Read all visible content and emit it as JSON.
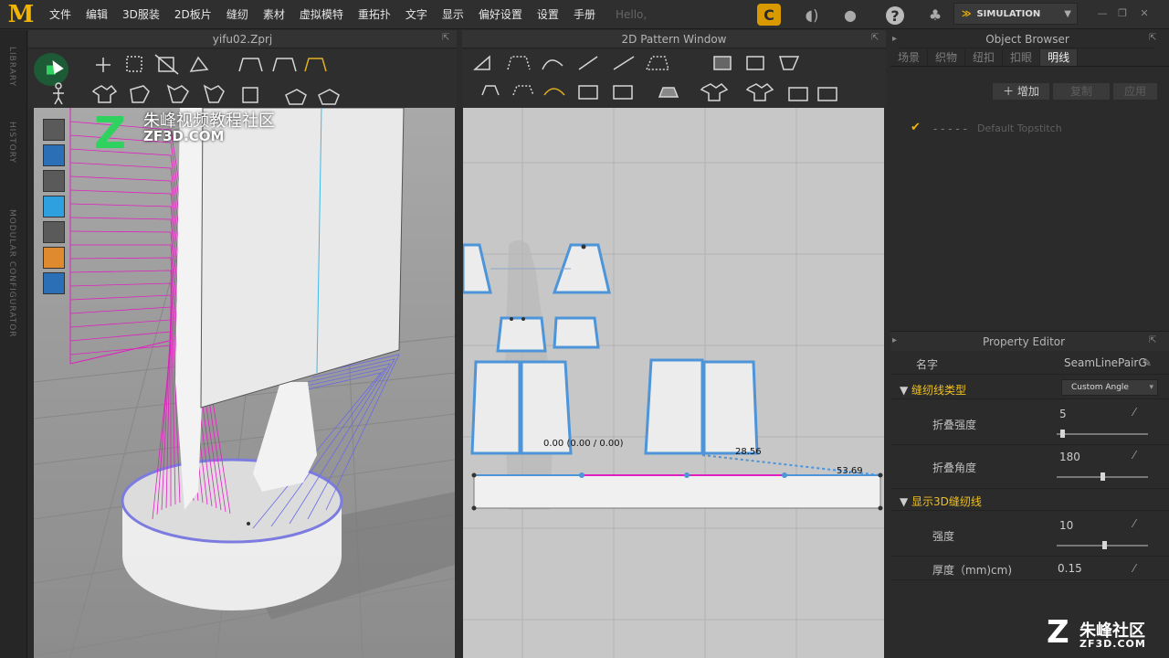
{
  "menubar": {
    "logo": "M",
    "items": [
      "文件",
      "编辑",
      "3D服装",
      "2D板片",
      "缝纫",
      "素材",
      "虚拟模特",
      "重拓扑",
      "文字",
      "显示",
      "偏好设置",
      "设置",
      "手册"
    ],
    "hello": "Hello,",
    "simulation_label": "SIMULATION"
  },
  "left_rail": {
    "labels": [
      "LIBRARY",
      "HISTORY",
      "MODULAR CONFIGURATOR"
    ]
  },
  "view3d": {
    "title": "yifu02.Zprj",
    "watermark_cn": "朱峰视频教程社区",
    "watermark_en": "ZF3D.COM"
  },
  "view2d": {
    "title": "2D Pattern Window",
    "measure_a": "0.00 (0.00 / 0.00)",
    "measure_b": "28.56",
    "measure_c": "53.69"
  },
  "object_browser": {
    "title": "Object Browser",
    "tabs": [
      "场景",
      "织物",
      "纽扣",
      "扣眼",
      "明线"
    ],
    "active_tab": "明线",
    "add_label": "增加",
    "copy_label": "复制",
    "apply_label": "应用",
    "topstitch_dashes": "- - - - -",
    "topstitch_label": "Default Topstitch"
  },
  "property_editor": {
    "title": "Property Editor",
    "name_label": "名字",
    "name_value": "SeamLinePairG",
    "section_seam_type": "缝纫线类型",
    "seam_type_value": "Custom Angle",
    "fold_strength_label": "折叠强度",
    "fold_strength_value": "5",
    "fold_strength_level": 0.04,
    "fold_angle_label": "折叠角度",
    "fold_angle_value": "180",
    "fold_angle_level": 0.5,
    "section_show_3d": "显示3D缝纫线",
    "intensity_label": "强度",
    "intensity_value": "10",
    "intensity_level": 0.53,
    "thickness_label": "厚度（mm)cm)",
    "thickness_value": "0.15"
  },
  "bottom_watermark": {
    "cn": "朱峰社区",
    "en": "ZF3D.COM"
  }
}
